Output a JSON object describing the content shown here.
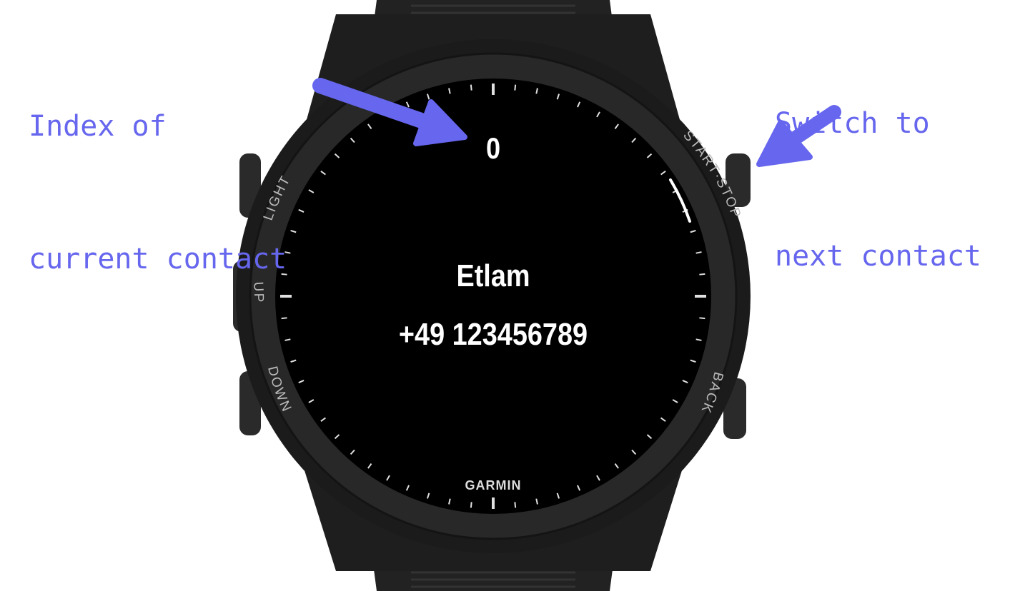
{
  "annotations": {
    "left": {
      "lines": [
        "Index of",
        "current contact"
      ]
    },
    "right": {
      "lines": [
        "Switch to",
        "next contact"
      ]
    },
    "color": "#6666ee"
  },
  "watch": {
    "brand": "GARMIN",
    "buttons": {
      "light": "LIGHT",
      "up": "UP",
      "down": "DOWN",
      "start_stop": "START·STOP",
      "back": "BACK"
    },
    "screen": {
      "contact_index": "0",
      "contact_name": "Etlam",
      "contact_phone": "+49 123456789"
    },
    "colors": {
      "body": "#1c1c1c",
      "bezel": "#262626",
      "screen": "#000000",
      "text": "#ffffff"
    }
  }
}
